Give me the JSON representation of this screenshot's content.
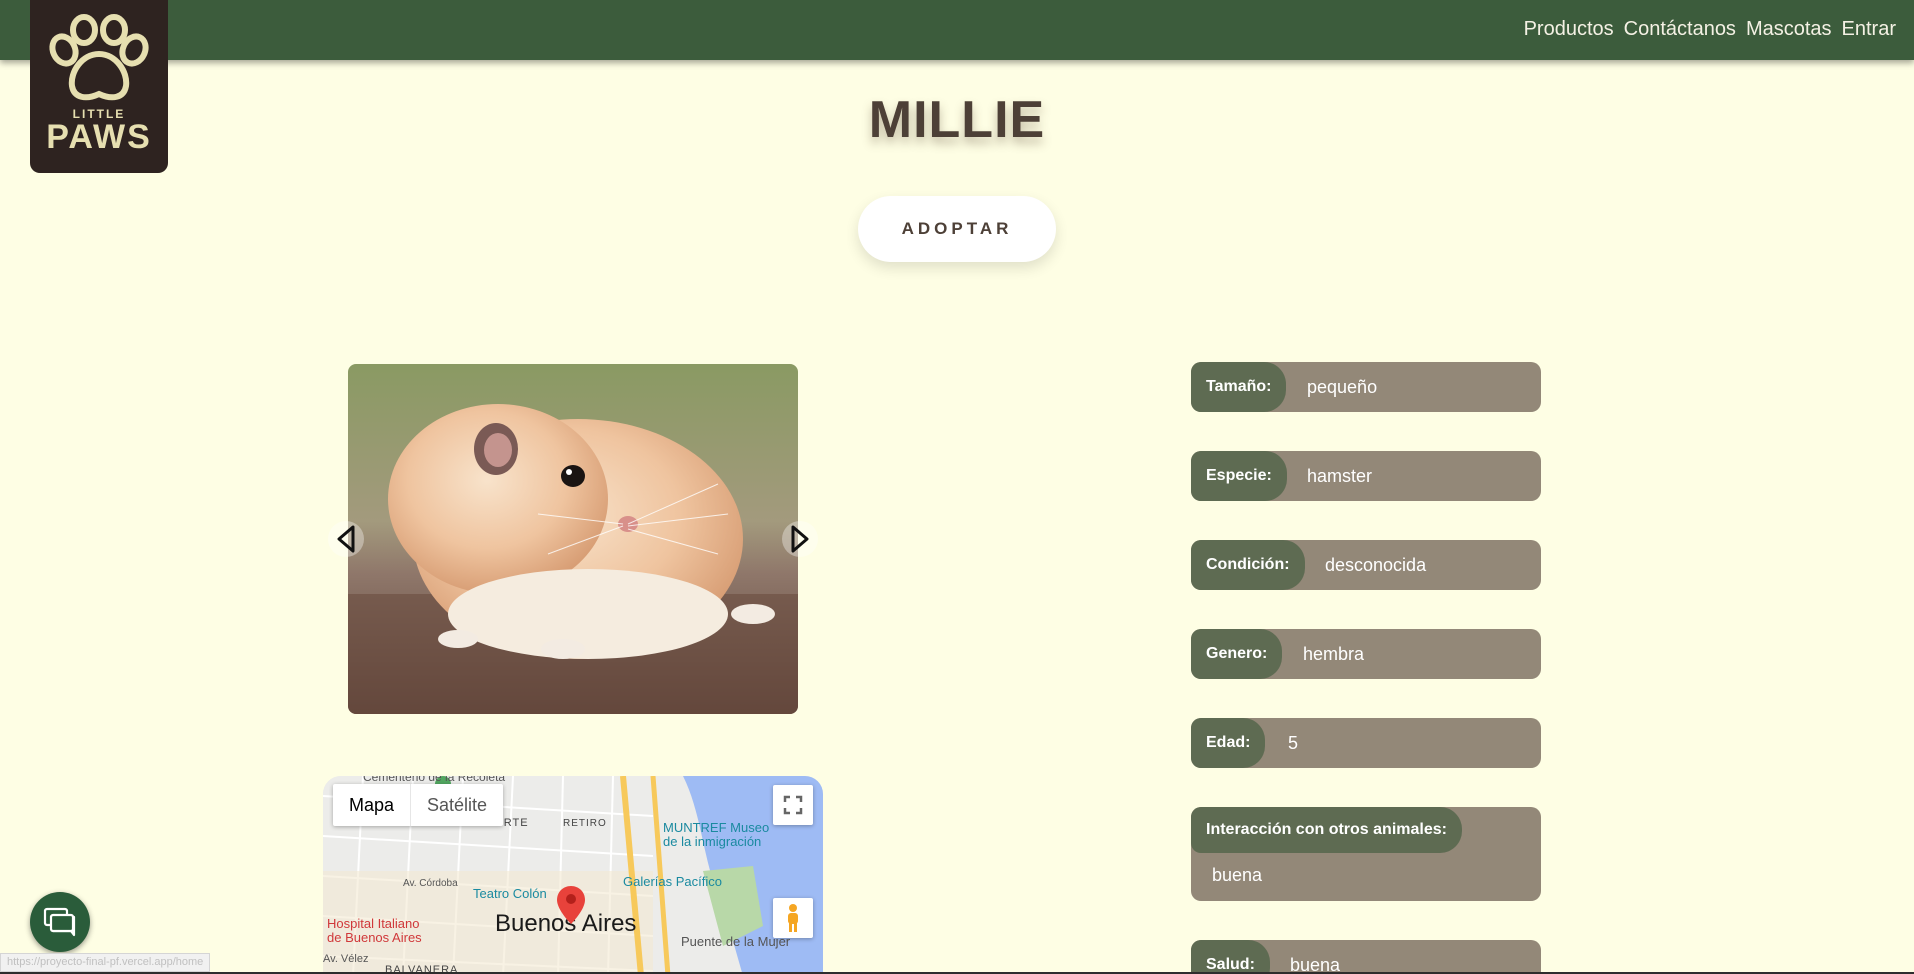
{
  "nav": {
    "links": [
      "Productos",
      "Contáctanos",
      "Mascotas",
      "Entrar"
    ]
  },
  "logo": {
    "line1": "LITTLE",
    "line2": "PAWS"
  },
  "pet": {
    "name": "MILLIE",
    "adopt_label": "ADOPTAR"
  },
  "info": [
    {
      "label": "Tamaño:",
      "value": "pequeño"
    },
    {
      "label": "Especie:",
      "value": "hamster"
    },
    {
      "label": "Condición:",
      "value": "desconocida"
    },
    {
      "label": "Genero:",
      "value": "hembra"
    },
    {
      "label": "Edad:",
      "value": "5"
    },
    {
      "label": "Interacción con otros animales:",
      "value": "buena"
    },
    {
      "label": "Salud:",
      "value": "buena"
    }
  ],
  "map": {
    "tabs": [
      "Mapa",
      "Satélite"
    ],
    "city": "Buenos Aires",
    "places": {
      "recoleta": "Cementerio de la Recoleta",
      "barrio_norte": "BARRIO NORTE",
      "retiro": "RETIRO",
      "muntref_1": "MUNTREF Museo",
      "muntref_2": "de la inmigración",
      "galerias": "Galerías Pacífico",
      "teatro": "Teatro Colón",
      "alvear": "Av. Córdoba",
      "hospital_1": "Hospital Italiano",
      "hospital_2": "de Buenos Aires",
      "puente": "Puente de la Mujer",
      "velez": "Av. Vélez",
      "balvanera": "BALVANERA"
    }
  },
  "status_url": "https://proyecto-final-pf.vercel.app/home",
  "colors": {
    "navbar": "#3c5c3c",
    "background": "#fefee4",
    "info_bg": "#938878",
    "info_label_bg": "#5e6b52",
    "chat": "#2a5c3a"
  }
}
